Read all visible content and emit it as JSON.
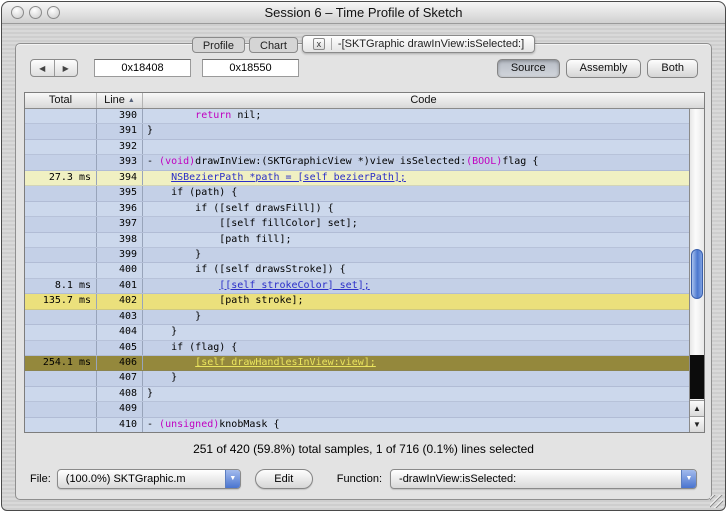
{
  "window": {
    "title": "Session 6 – Time Profile of Sketch"
  },
  "tabs": {
    "close_glyph": "x",
    "items": [
      {
        "label": "Profile",
        "selected": false
      },
      {
        "label": "Chart",
        "selected": false
      },
      {
        "label": "-[SKTGraphic drawInView:isSelected:]",
        "selected": true
      }
    ]
  },
  "toolbar": {
    "back_glyph": "◀",
    "forward_glyph": "▶",
    "address_start": "0x18408",
    "address_end": "0x18550",
    "view_buttons": [
      {
        "label": "Source",
        "selected": true
      },
      {
        "label": "Assembly",
        "selected": false
      },
      {
        "label": "Both",
        "selected": false
      }
    ]
  },
  "source_table": {
    "columns": {
      "total": "Total",
      "line": "Line",
      "code": "Code"
    },
    "sort_glyph": "▲",
    "syntax_keywords": [
      "(void)",
      "(BOOL)",
      "(unsigned)",
      "return"
    ],
    "rows": [
      {
        "line": "390",
        "total": "",
        "code": "        return nil;"
      },
      {
        "line": "391",
        "total": "",
        "code": "}"
      },
      {
        "line": "392",
        "total": "",
        "code": ""
      },
      {
        "line": "393",
        "total": "",
        "code": "- (void)drawInView:(SKTGraphicView *)view isSelected:(BOOL)flag {"
      },
      {
        "line": "394",
        "total": "27.3 ms",
        "code": "    NSBezierPath *path = [self bezierPath];",
        "bg": "#f0f0c2",
        "link": true,
        "link_color": "#2a2ec8"
      },
      {
        "line": "395",
        "total": "",
        "code": "    if (path) {"
      },
      {
        "line": "396",
        "total": "",
        "code": "        if ([self drawsFill]) {"
      },
      {
        "line": "397",
        "total": "",
        "code": "            [[self fillColor] set];"
      },
      {
        "line": "398",
        "total": "",
        "code": "            [path fill];"
      },
      {
        "line": "399",
        "total": "",
        "code": "        }"
      },
      {
        "line": "400",
        "total": "",
        "code": "        if ([self drawsStroke]) {"
      },
      {
        "line": "401",
        "total": "8.1 ms",
        "code": "            [[self strokeColor] set];",
        "link": true,
        "link_color": "#2a2ec8"
      },
      {
        "line": "402",
        "total": "135.7 ms",
        "code": "            [path stroke];",
        "bg": "#ebe07c"
      },
      {
        "line": "403",
        "total": "",
        "code": "        }"
      },
      {
        "line": "404",
        "total": "",
        "code": "    }"
      },
      {
        "line": "405",
        "total": "",
        "code": "    if (flag) {"
      },
      {
        "line": "406",
        "total": "254.1 ms",
        "code": "        [self drawHandlesInView:view];",
        "bg": "#94883c",
        "link": true,
        "link_color": "#ebe55e"
      },
      {
        "line": "407",
        "total": "",
        "code": "    }"
      },
      {
        "line": "408",
        "total": "",
        "code": "}"
      },
      {
        "line": "409",
        "total": "",
        "code": ""
      },
      {
        "line": "410",
        "total": "",
        "code": "- (unsigned)knobMask {"
      }
    ]
  },
  "status_bar": {
    "text": "251 of 420 (59.8%) total samples, 1 of 716 (0.1%) lines selected"
  },
  "footer": {
    "file_label": "File:",
    "file_popup": "(100.0%) SKTGraphic.m",
    "edit_button": "Edit",
    "function_label": "Function:",
    "function_popup": "-drawInView:isSelected:",
    "popup_arrow": "▼"
  },
  "icons": {
    "scroll_up": "▲",
    "scroll_down": "▼"
  },
  "colors": {
    "row_even": "#ccd8ec",
    "row_odd": "#c4d0e7",
    "keyword": "#c000c0"
  }
}
